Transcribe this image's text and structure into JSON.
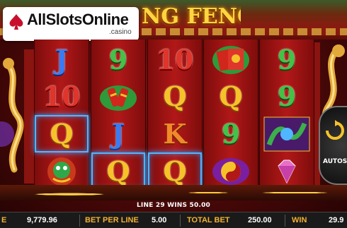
{
  "logo": {
    "main": "AllSlotsOnline",
    "sub": ".casino"
  },
  "game": {
    "title": "NG FENG"
  },
  "reels": [
    [
      {
        "symbol": "J",
        "color": "blue",
        "win": false
      },
      {
        "symbol": "10",
        "color": "red",
        "win": false
      },
      {
        "symbol": "Q",
        "color": "gold",
        "win": true
      },
      {
        "symbol": "dragon",
        "color": "gold",
        "win": false
      }
    ],
    [
      {
        "symbol": "9",
        "color": "green",
        "win": false
      },
      {
        "symbol": "firecrackers",
        "color": "red",
        "win": false
      },
      {
        "symbol": "J",
        "color": "blue",
        "win": false
      },
      {
        "symbol": "Q",
        "color": "gold",
        "win": true
      }
    ],
    [
      {
        "symbol": "10",
        "color": "red",
        "win": false
      },
      {
        "symbol": "Q",
        "color": "gold",
        "win": false
      },
      {
        "symbol": "K",
        "color": "orange",
        "win": false
      },
      {
        "symbol": "Q",
        "color": "gold",
        "win": true
      }
    ],
    [
      {
        "symbol": "red-envelope",
        "color": "red",
        "win": false
      },
      {
        "symbol": "Q",
        "color": "gold",
        "win": false
      },
      {
        "symbol": "9",
        "color": "green",
        "win": false
      },
      {
        "symbol": "yin-yang",
        "color": "gold",
        "win": false
      }
    ],
    [
      {
        "symbol": "9",
        "color": "green",
        "win": false
      },
      {
        "symbol": "9",
        "color": "green",
        "win": false
      },
      {
        "symbol": "dragon-pearl",
        "color": "purple",
        "win": false
      },
      {
        "symbol": "diamond",
        "color": "pink",
        "win": false
      }
    ]
  ],
  "status": {
    "win_line": "LINE 29 WINS 50.00"
  },
  "autospin": {
    "label": "AUTOSP"
  },
  "bar": {
    "balance_label": "E",
    "balance": "9,779.96",
    "bet_per_line_label": "BET PER LINE",
    "bet_per_line": "5.00",
    "total_bet_label": "TOTAL BET",
    "total_bet": "250.00",
    "win_label": "WIN",
    "win": "29.9"
  },
  "colors": {
    "accent": "#f2b233",
    "win_highlight": "#4fb6ff",
    "reel_bg": "#b11818"
  }
}
